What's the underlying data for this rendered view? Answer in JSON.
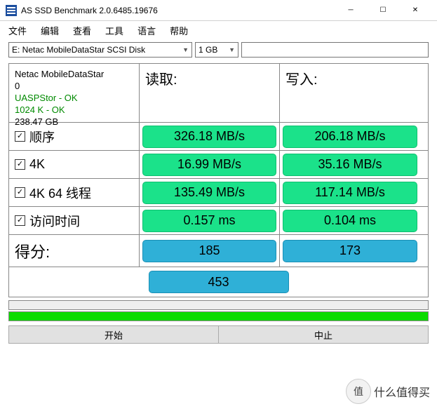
{
  "window": {
    "title": "AS SSD Benchmark 2.0.6485.19676"
  },
  "menu": {
    "file": "文件",
    "edit": "编辑",
    "view": "查看",
    "tools": "工具",
    "lang": "语言",
    "help": "帮助"
  },
  "toolbar": {
    "drive": "E: Netac MobileDataStar SCSI Disk",
    "size": "1 GB"
  },
  "info": {
    "name": "Netac MobileDataStar",
    "rev": "0",
    "driver": "UASPStor - OK",
    "align": "1024 K - OK",
    "cap": "238.47 GB"
  },
  "headers": {
    "read": "读取:",
    "write": "写入:"
  },
  "rows": {
    "seq": {
      "label": "顺序",
      "read": "326.18 MB/s",
      "write": "206.18 MB/s"
    },
    "4k": {
      "label": "4K",
      "read": "16.99 MB/s",
      "write": "35.16 MB/s"
    },
    "4k64": {
      "label": "4K 64 线程",
      "read": "135.49 MB/s",
      "write": "117.14 MB/s"
    },
    "acc": {
      "label": "访问时间",
      "read": "0.157 ms",
      "write": "0.104 ms"
    }
  },
  "score": {
    "label": "得分:",
    "read": "185",
    "write": "173",
    "total": "453"
  },
  "buttons": {
    "start": "开始",
    "abort": "中止"
  },
  "watermark": {
    "circle": "值",
    "text": "什么值得买"
  }
}
